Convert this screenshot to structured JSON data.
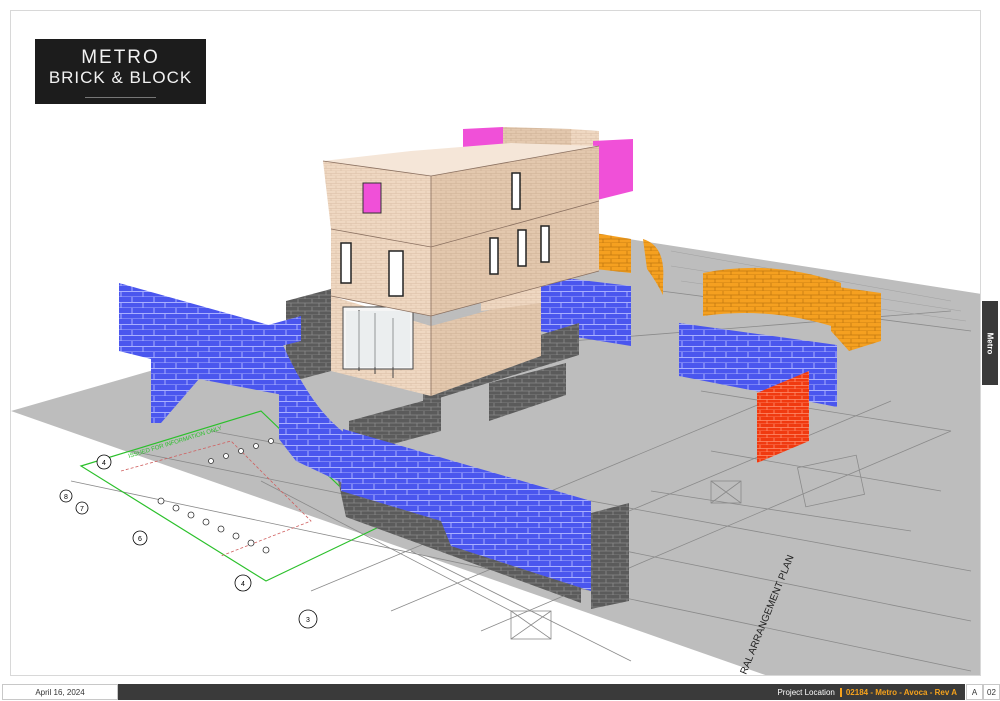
{
  "logo": {
    "line1": "METRO",
    "line2": "BRICK & BLOCK"
  },
  "side_tab": "Metro",
  "plan": {
    "title": "RAL ARRANGEMENT PLAN",
    "green_note": "ISSUED FOR INFORMATION ONLY",
    "grid_markers": [
      "4",
      "8",
      "7",
      "6",
      "4",
      "3"
    ]
  },
  "footer": {
    "date": "April 16, 2024",
    "project_label": "Project Location",
    "project_code": "02184 - Metro - Avoca - Rev A",
    "revision": "A",
    "page": "02"
  },
  "colors": {
    "blue_wall": "#4a56ee",
    "orange_wall": "#f5a020",
    "red_wall": "#f03a10",
    "magenta_wall": "#f050d8",
    "grey_block": "#5b5b5b",
    "beige_brick": "#efd8c2",
    "plan_ground": "#bdbdbd",
    "accent": "#f6a21c"
  }
}
